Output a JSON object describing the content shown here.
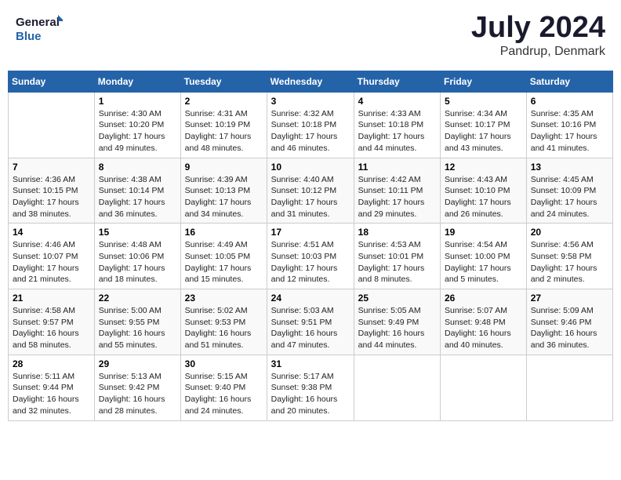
{
  "header": {
    "logo_line1": "General",
    "logo_line2": "Blue",
    "month": "July 2024",
    "location": "Pandrup, Denmark"
  },
  "days_of_week": [
    "Sunday",
    "Monday",
    "Tuesday",
    "Wednesday",
    "Thursday",
    "Friday",
    "Saturday"
  ],
  "weeks": [
    [
      {
        "day": "",
        "sunrise": "",
        "sunset": "",
        "daylight": ""
      },
      {
        "day": "1",
        "sunrise": "Sunrise: 4:30 AM",
        "sunset": "Sunset: 10:20 PM",
        "daylight": "Daylight: 17 hours and 49 minutes."
      },
      {
        "day": "2",
        "sunrise": "Sunrise: 4:31 AM",
        "sunset": "Sunset: 10:19 PM",
        "daylight": "Daylight: 17 hours and 48 minutes."
      },
      {
        "day": "3",
        "sunrise": "Sunrise: 4:32 AM",
        "sunset": "Sunset: 10:18 PM",
        "daylight": "Daylight: 17 hours and 46 minutes."
      },
      {
        "day": "4",
        "sunrise": "Sunrise: 4:33 AM",
        "sunset": "Sunset: 10:18 PM",
        "daylight": "Daylight: 17 hours and 44 minutes."
      },
      {
        "day": "5",
        "sunrise": "Sunrise: 4:34 AM",
        "sunset": "Sunset: 10:17 PM",
        "daylight": "Daylight: 17 hours and 43 minutes."
      },
      {
        "day": "6",
        "sunrise": "Sunrise: 4:35 AM",
        "sunset": "Sunset: 10:16 PM",
        "daylight": "Daylight: 17 hours and 41 minutes."
      }
    ],
    [
      {
        "day": "7",
        "sunrise": "Sunrise: 4:36 AM",
        "sunset": "Sunset: 10:15 PM",
        "daylight": "Daylight: 17 hours and 38 minutes."
      },
      {
        "day": "8",
        "sunrise": "Sunrise: 4:38 AM",
        "sunset": "Sunset: 10:14 PM",
        "daylight": "Daylight: 17 hours and 36 minutes."
      },
      {
        "day": "9",
        "sunrise": "Sunrise: 4:39 AM",
        "sunset": "Sunset: 10:13 PM",
        "daylight": "Daylight: 17 hours and 34 minutes."
      },
      {
        "day": "10",
        "sunrise": "Sunrise: 4:40 AM",
        "sunset": "Sunset: 10:12 PM",
        "daylight": "Daylight: 17 hours and 31 minutes."
      },
      {
        "day": "11",
        "sunrise": "Sunrise: 4:42 AM",
        "sunset": "Sunset: 10:11 PM",
        "daylight": "Daylight: 17 hours and 29 minutes."
      },
      {
        "day": "12",
        "sunrise": "Sunrise: 4:43 AM",
        "sunset": "Sunset: 10:10 PM",
        "daylight": "Daylight: 17 hours and 26 minutes."
      },
      {
        "day": "13",
        "sunrise": "Sunrise: 4:45 AM",
        "sunset": "Sunset: 10:09 PM",
        "daylight": "Daylight: 17 hours and 24 minutes."
      }
    ],
    [
      {
        "day": "14",
        "sunrise": "Sunrise: 4:46 AM",
        "sunset": "Sunset: 10:07 PM",
        "daylight": "Daylight: 17 hours and 21 minutes."
      },
      {
        "day": "15",
        "sunrise": "Sunrise: 4:48 AM",
        "sunset": "Sunset: 10:06 PM",
        "daylight": "Daylight: 17 hours and 18 minutes."
      },
      {
        "day": "16",
        "sunrise": "Sunrise: 4:49 AM",
        "sunset": "Sunset: 10:05 PM",
        "daylight": "Daylight: 17 hours and 15 minutes."
      },
      {
        "day": "17",
        "sunrise": "Sunrise: 4:51 AM",
        "sunset": "Sunset: 10:03 PM",
        "daylight": "Daylight: 17 hours and 12 minutes."
      },
      {
        "day": "18",
        "sunrise": "Sunrise: 4:53 AM",
        "sunset": "Sunset: 10:01 PM",
        "daylight": "Daylight: 17 hours and 8 minutes."
      },
      {
        "day": "19",
        "sunrise": "Sunrise: 4:54 AM",
        "sunset": "Sunset: 10:00 PM",
        "daylight": "Daylight: 17 hours and 5 minutes."
      },
      {
        "day": "20",
        "sunrise": "Sunrise: 4:56 AM",
        "sunset": "Sunset: 9:58 PM",
        "daylight": "Daylight: 17 hours and 2 minutes."
      }
    ],
    [
      {
        "day": "21",
        "sunrise": "Sunrise: 4:58 AM",
        "sunset": "Sunset: 9:57 PM",
        "daylight": "Daylight: 16 hours and 58 minutes."
      },
      {
        "day": "22",
        "sunrise": "Sunrise: 5:00 AM",
        "sunset": "Sunset: 9:55 PM",
        "daylight": "Daylight: 16 hours and 55 minutes."
      },
      {
        "day": "23",
        "sunrise": "Sunrise: 5:02 AM",
        "sunset": "Sunset: 9:53 PM",
        "daylight": "Daylight: 16 hours and 51 minutes."
      },
      {
        "day": "24",
        "sunrise": "Sunrise: 5:03 AM",
        "sunset": "Sunset: 9:51 PM",
        "daylight": "Daylight: 16 hours and 47 minutes."
      },
      {
        "day": "25",
        "sunrise": "Sunrise: 5:05 AM",
        "sunset": "Sunset: 9:49 PM",
        "daylight": "Daylight: 16 hours and 44 minutes."
      },
      {
        "day": "26",
        "sunrise": "Sunrise: 5:07 AM",
        "sunset": "Sunset: 9:48 PM",
        "daylight": "Daylight: 16 hours and 40 minutes."
      },
      {
        "day": "27",
        "sunrise": "Sunrise: 5:09 AM",
        "sunset": "Sunset: 9:46 PM",
        "daylight": "Daylight: 16 hours and 36 minutes."
      }
    ],
    [
      {
        "day": "28",
        "sunrise": "Sunrise: 5:11 AM",
        "sunset": "Sunset: 9:44 PM",
        "daylight": "Daylight: 16 hours and 32 minutes."
      },
      {
        "day": "29",
        "sunrise": "Sunrise: 5:13 AM",
        "sunset": "Sunset: 9:42 PM",
        "daylight": "Daylight: 16 hours and 28 minutes."
      },
      {
        "day": "30",
        "sunrise": "Sunrise: 5:15 AM",
        "sunset": "Sunset: 9:40 PM",
        "daylight": "Daylight: 16 hours and 24 minutes."
      },
      {
        "day": "31",
        "sunrise": "Sunrise: 5:17 AM",
        "sunset": "Sunset: 9:38 PM",
        "daylight": "Daylight: 16 hours and 20 minutes."
      },
      {
        "day": "",
        "sunrise": "",
        "sunset": "",
        "daylight": ""
      },
      {
        "day": "",
        "sunrise": "",
        "sunset": "",
        "daylight": ""
      },
      {
        "day": "",
        "sunrise": "",
        "sunset": "",
        "daylight": ""
      }
    ]
  ]
}
